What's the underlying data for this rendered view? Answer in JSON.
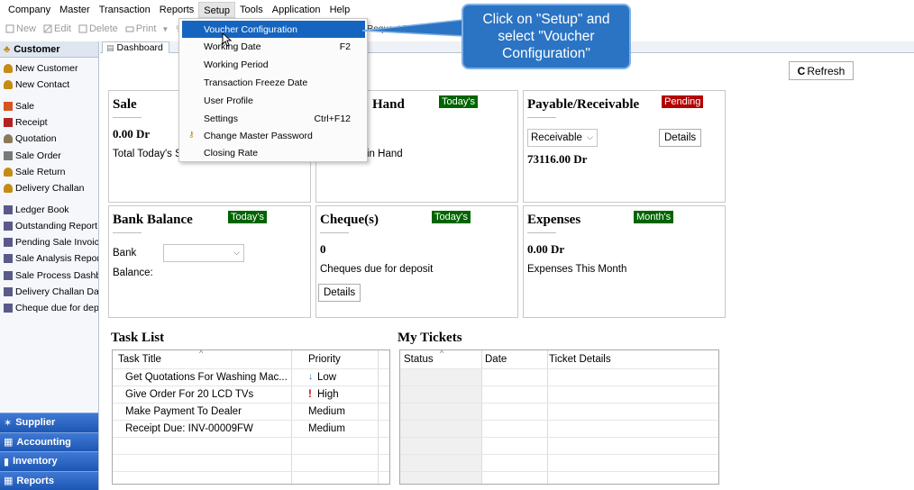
{
  "menubar": {
    "items": [
      "Company",
      "Master",
      "Transaction",
      "Reports",
      "Setup",
      "Tools",
      "Application",
      "Help"
    ]
  },
  "toolbar": {
    "new": "New",
    "edit": "Edit",
    "delete": "Delete",
    "print": "Print",
    "more": "P",
    "request_feature": "Request Feature"
  },
  "sidebar": {
    "header": "Customer",
    "items": [
      {
        "label": "New Customer",
        "icon": "person-icon",
        "color": "#c58b12"
      },
      {
        "label": "New Contact",
        "icon": "person-icon",
        "color": "#c58b12"
      },
      {
        "label": "Sale",
        "icon": "sale-icon",
        "color": "#d9541e"
      },
      {
        "label": "Receipt",
        "icon": "receipt-icon",
        "color": "#b22222"
      },
      {
        "label": "Quotation",
        "icon": "person-icon",
        "color": "#8a7a5a"
      },
      {
        "label": "Sale Order",
        "icon": "order-icon",
        "color": "#7a7a7a"
      },
      {
        "label": "Sale Return",
        "icon": "person-icon",
        "color": "#c58b12"
      },
      {
        "label": "Delivery Challan",
        "icon": "person-icon",
        "color": "#c58b12"
      },
      {
        "label": "Ledger Book",
        "icon": "report-icon",
        "color": "#5a5a8a"
      },
      {
        "label": "Outstanding Report",
        "icon": "report-icon",
        "color": "#5a5a8a"
      },
      {
        "label": "Pending Sale Invoices",
        "icon": "report-icon",
        "color": "#5a5a8a"
      },
      {
        "label": "Sale Analysis Report",
        "icon": "report-icon",
        "color": "#5a5a8a"
      },
      {
        "label": "Sale Process Dashboa",
        "icon": "report-icon",
        "color": "#5a5a8a"
      },
      {
        "label": "Delivery Challan Dashl",
        "icon": "report-icon",
        "color": "#5a5a8a"
      },
      {
        "label": "Cheque due for depos",
        "icon": "report-icon",
        "color": "#5a5a8a"
      }
    ],
    "sections": [
      "Supplier",
      "Accounting",
      "Inventory",
      "Reports"
    ]
  },
  "tab": {
    "dashboard": "Dashboard"
  },
  "refresh_label": "Refresh",
  "cards": {
    "sale": {
      "title": "Sale",
      "value": "0.00 Dr",
      "sub": "Total Today's S"
    },
    "cash": {
      "title": "Hand",
      "badge": "Today's",
      "sub": "in Hand"
    },
    "payable": {
      "title": "Payable/Receivable",
      "badge": "Pending",
      "select": "Receivable",
      "details": "Details",
      "value": "73116.00 Dr"
    },
    "bank": {
      "title": "Bank Balance",
      "badge": "Today's",
      "bank_label": "Bank",
      "balance_label": "Balance:"
    },
    "cheque": {
      "title": "Cheque(s)",
      "badge": "Today's",
      "value": "0",
      "sub": "Cheques due for deposit",
      "details": "Details"
    },
    "expenses": {
      "title": "Expenses",
      "badge": "Month's",
      "value": "0.00 Dr",
      "sub": "Expenses This Month"
    }
  },
  "task_list": {
    "title": "Task List",
    "headers": [
      "Task Title",
      "Priority"
    ],
    "rows": [
      {
        "title": "Get Quotations For Washing Mac...",
        "priority": "Low",
        "mark": "↓"
      },
      {
        "title": "Give Order For 20 LCD TVs",
        "priority": "High",
        "mark": "!"
      },
      {
        "title": "Make Payment To Dealer",
        "priority": "Medium",
        "mark": ""
      },
      {
        "title": "Receipt Due: INV-00009FW",
        "priority": "Medium",
        "mark": ""
      }
    ]
  },
  "tickets": {
    "title": "My Tickets",
    "headers": [
      "Status",
      "Date",
      "Ticket Details"
    ]
  },
  "setup_menu": {
    "items": [
      {
        "label": "Voucher Configuration",
        "shortcut": ""
      },
      {
        "label": "Working Date",
        "shortcut": "F2"
      },
      {
        "label": "Working Period",
        "shortcut": ""
      },
      {
        "label": "Transaction Freeze Date",
        "shortcut": ""
      },
      {
        "label": "User Profile",
        "shortcut": ""
      },
      {
        "label": "Settings",
        "shortcut": "Ctrl+F12"
      },
      {
        "label": "Change Master Password",
        "shortcut": ""
      },
      {
        "label": "Closing Rate",
        "shortcut": ""
      }
    ]
  },
  "callout": {
    "text": "Click on \"Setup\" and select \"Voucher Configuration\""
  },
  "colors": {
    "accent": "#1565c0",
    "badge_green": "#006400",
    "badge_red": "#b30000",
    "sidebar_section": "#1d57b4"
  }
}
